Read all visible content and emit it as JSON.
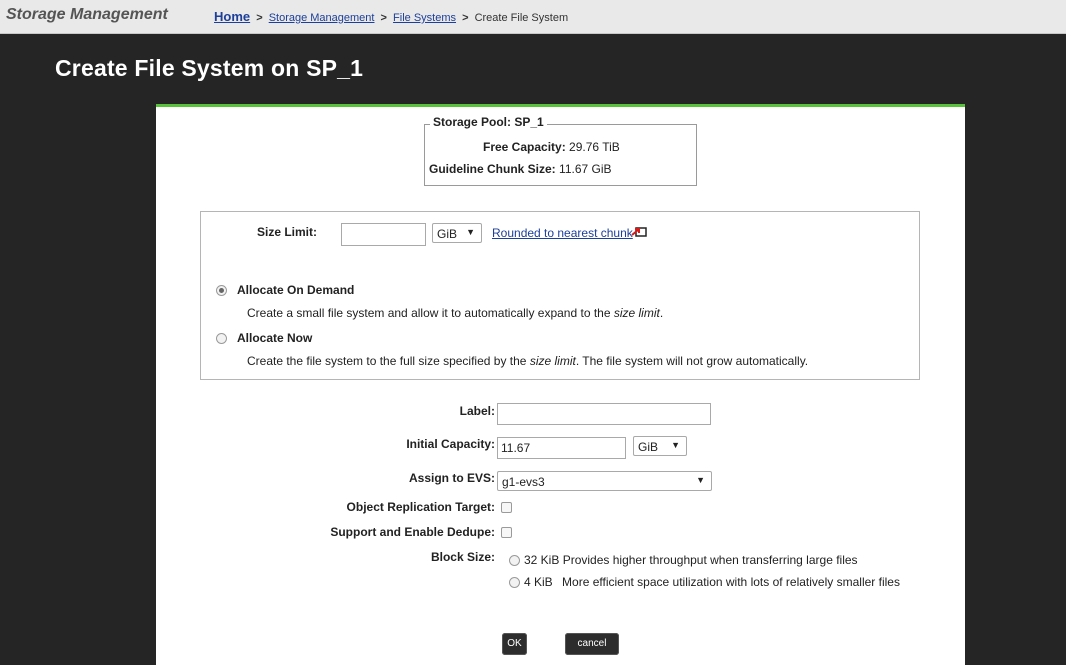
{
  "header": {
    "app_title": "Storage Management",
    "breadcrumb": {
      "home": "Home",
      "sep": ">",
      "storage_management": "Storage Management",
      "file_systems": "File Systems",
      "current": "Create File System"
    }
  },
  "page": {
    "title": "Create File System on SP_1"
  },
  "pool": {
    "legend": "Storage Pool: SP_1",
    "free_capacity_label": "Free Capacity:",
    "free_capacity_value": "29.76 TiB",
    "chunk_label": "Guideline Chunk Size:",
    "chunk_value": "11.67 GiB"
  },
  "allocation": {
    "size_limit_label": "Size Limit:",
    "size_limit_value": "",
    "size_limit_unit": "GiB",
    "rounded_link": "Rounded to nearest chunk",
    "on_demand": {
      "label": "Allocate On Demand",
      "selected": true,
      "desc_prefix": "Create a small file system and allow it to automatically expand to the ",
      "desc_em": "size limit",
      "desc_suffix": "."
    },
    "now": {
      "label": "Allocate Now",
      "selected": false,
      "desc_prefix": "Create the file system to the full size specified by the ",
      "desc_em": "size limit",
      "desc_suffix": ". The file system will not grow automatically."
    }
  },
  "form": {
    "label_label": "Label:",
    "label_value": "",
    "initial_capacity_label": "Initial Capacity:",
    "initial_capacity_value": "11.67",
    "initial_capacity_unit": "GiB",
    "evs_label": "Assign to EVS:",
    "evs_value": "g1-evs3",
    "replication_label": "Object Replication Target:",
    "dedupe_label": "Support and Enable Dedupe:",
    "block_size_label": "Block Size:",
    "block_32": {
      "size": "32 KiB",
      "desc": "Provides higher throughput when transferring large files"
    },
    "block_4": {
      "size": "4 KiB",
      "desc": "More efficient space utilization with lots of relatively smaller files"
    }
  },
  "actions": {
    "ok": "OK",
    "cancel": "cancel"
  },
  "colors": {
    "accent": "#58c23a",
    "background": "#252525",
    "link": "#1d3f9a"
  }
}
